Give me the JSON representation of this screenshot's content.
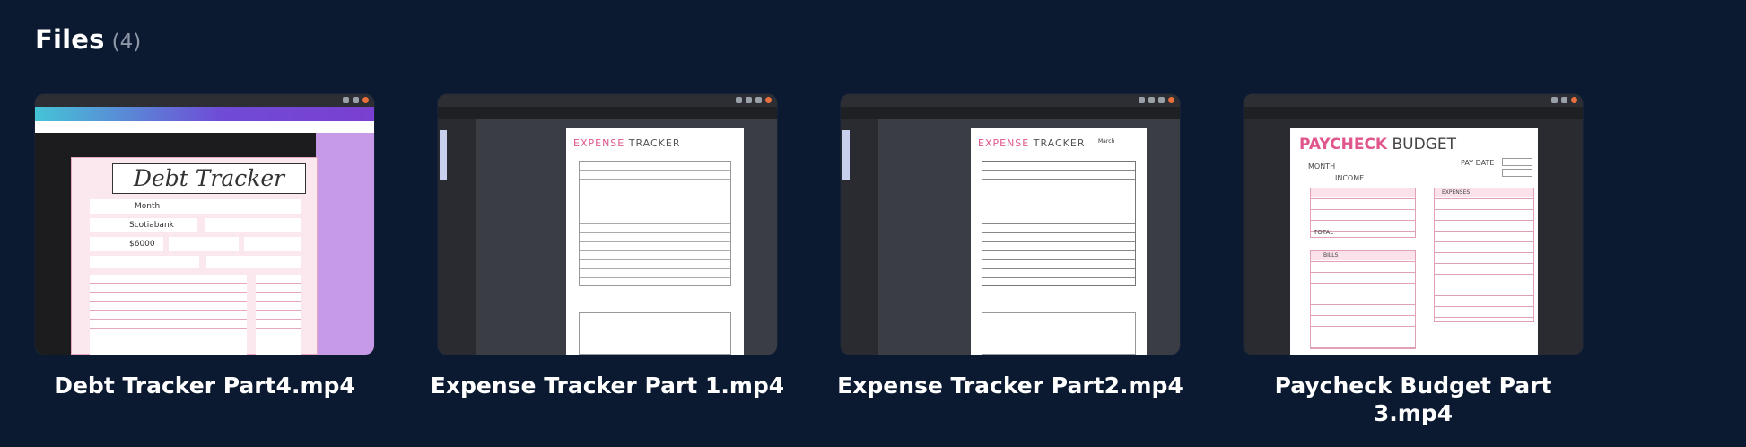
{
  "header": {
    "title": "Files",
    "count": "(4)"
  },
  "files": [
    {
      "caption": "Debt Tracker Part4.mp4",
      "thumb_title": "Debt Tracker",
      "fields": [
        "Month",
        "Scotiabank",
        "$6000"
      ]
    },
    {
      "caption": "Expense Tracker Part 1.mp4",
      "thumb_title_a": "EXPENSE",
      "thumb_title_b": "TRACKER"
    },
    {
      "caption": "Expense Tracker Part2.mp4",
      "thumb_title_a": "EXPENSE",
      "thumb_title_b": "TRACKER",
      "month": "March"
    },
    {
      "caption": "Paycheck Budget Part 3.mp4",
      "thumb_title_a": "PAYCHECK",
      "thumb_title_b": "BUDGET",
      "labels": [
        "MONTH",
        "PAY DATE",
        "INCOME",
        "EXPENSES",
        "BILLS",
        "TOTAL"
      ]
    }
  ],
  "colors": {
    "background": "#0b1a30",
    "accent_pink": "#e0578d"
  }
}
